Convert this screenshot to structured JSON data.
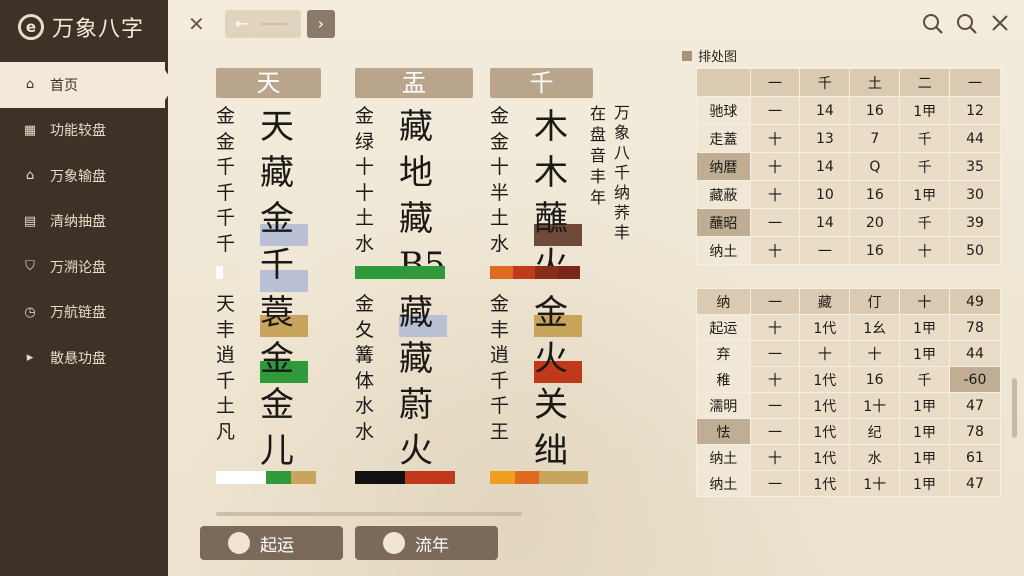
{
  "app": {
    "logo_glyph": "e",
    "title": "万象八字"
  },
  "sidebar": {
    "items": [
      {
        "label": "首页",
        "icon": "home-icon",
        "active": true
      },
      {
        "label": "功能较盘",
        "icon": "grid-icon",
        "active": false
      },
      {
        "label": "万象输盘",
        "icon": "house-icon",
        "active": false
      },
      {
        "label": "清纳抽盘",
        "icon": "list-icon",
        "active": false
      },
      {
        "label": "万溯论盘",
        "icon": "shield-icon",
        "active": false
      },
      {
        "label": "万航链盘",
        "icon": "compass-icon",
        "active": false
      },
      {
        "label": "散悬功盘",
        "icon": "play-icon",
        "active": false
      }
    ]
  },
  "topbar": {
    "close": "✕",
    "back": "←",
    "forward": "›",
    "icons": [
      "search-outline-icon",
      "search-icon",
      "close-icon"
    ]
  },
  "columns": [
    {
      "head": "天",
      "top_small": "金\n金\n千\n千\n千\n千",
      "top_big": "天\n藏\n金\n千",
      "top_strip": [
        "#ffffff",
        "#efe6d3",
        "#efe6d3",
        "#efe6d3"
      ],
      "bottom_small": "天\n丰\n逍\n千\n土\n凡",
      "bottom_big": "蓑\n金\n金\n儿",
      "bottom_strip": [
        "#ffffff",
        "#ffffff",
        "#2e9a3b",
        "#c9a45c"
      ]
    },
    {
      "head": "盂",
      "top_small": "金\n绿\n十\n十\n土\n水",
      "top_big": "藏\n地\n藏\nB5",
      "top_strip": [
        "#2e9a3b",
        "#2e9a3b",
        "#2e9a3b",
        "#2e9a3b"
      ],
      "bottom_small": "金\n夂\n篝\n体\n水\n水",
      "bottom_big": "藏\n藏\n蔚\n火",
      "bottom_strip": [
        "#111111",
        "#111111",
        "#c0391b",
        "#c0391b"
      ]
    },
    {
      "head": "千",
      "top_small": "金\n金\n十\n半\n土\n水",
      "top_big": "木\n木\n蘸\n火",
      "top_strip": [
        "#e06a1f",
        "#c0391b",
        "#8a2c1a",
        "#7a2718"
      ],
      "bottom_small": "金\n丰\n逍\n千\n千\n王",
      "bottom_big": "金\n火\n关\n绌",
      "bottom_strip": [
        "#f0a020",
        "#e06a1f",
        "#c9a45c",
        "#c9a45c"
      ]
    }
  ],
  "side_text": {
    "col1": "在\n盘\n音\n丰\n年",
    "col2": "万\n象\n八\n千\n纳\n荞\n丰",
    "col3": "年"
  },
  "legend": {
    "label": "排处图"
  },
  "table_top": {
    "header": [
      "",
      "一",
      "千",
      "土",
      "二",
      "一"
    ],
    "rows": [
      [
        "驰球",
        "一",
        "14",
        "16",
        "1甲",
        "12"
      ],
      [
        "走蓋",
        "十",
        "13",
        "7",
        "千",
        "44"
      ],
      [
        "纳暦",
        "十",
        "14",
        "Q",
        "千",
        "35"
      ],
      [
        "藏蔽",
        "十",
        "10",
        "16",
        "1甲",
        "30"
      ],
      [
        "蘸昭",
        "一",
        "14",
        "20",
        "千",
        "39"
      ],
      [
        "纳土",
        "十",
        "一",
        "16",
        "十",
        "50"
      ]
    ]
  },
  "table_bottom": {
    "header": [
      "纳",
      "一",
      "藏",
      "仃",
      "十",
      "49"
    ],
    "rows": [
      [
        "起运",
        "十",
        "1代",
        "1幺",
        "1甲",
        "78"
      ],
      [
        "弃",
        "一",
        "十",
        "十",
        "1甲",
        "44"
      ],
      [
        "稚",
        "十",
        "1代",
        "16",
        "千",
        "-60"
      ],
      [
        "濡明",
        "一",
        "1代",
        "1十",
        "1甲",
        "47"
      ],
      [
        "怯",
        "一",
        "1代",
        "纪",
        "1甲",
        "78"
      ],
      [
        "纳土",
        "十",
        "1代",
        "水",
        "1甲",
        "61"
      ],
      [
        "纳土",
        "一",
        "1代",
        "1十",
        "1甲",
        "47"
      ]
    ]
  },
  "bottom_buttons": [
    {
      "label": "起运"
    },
    {
      "label": "流年"
    }
  ]
}
